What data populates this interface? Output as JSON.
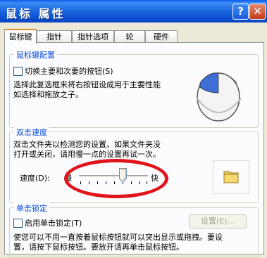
{
  "window": {
    "title": "鼠标 属性",
    "help_label": "?",
    "close_label": "✕"
  },
  "tabs": [
    "鼠标键",
    "指针",
    "指针选项",
    "轮",
    "硬件"
  ],
  "buttons_config": {
    "heading": "鼠标键配置",
    "switch_checkbox_label": "切换主要和次要的按钮(S)",
    "switch_checked": false,
    "description_line1": "选择此复选框来将右按钮设成用于主要性能",
    "description_line2": "如选择和拖放之子。"
  },
  "double_click": {
    "heading": "双击速度",
    "description_line1": "双击文件夹以检测您的设置。如果文件夹没",
    "description_line2": "打开或关闭，请用慢一点的设置再试一次。",
    "speed_label": "速度(D):",
    "slow_label": "慢",
    "fast_label": "快",
    "speed_value": 0.65,
    "test_folder_icon": "folder-icon"
  },
  "click_lock": {
    "heading": "单击锁定",
    "checkbox_label": "启用单击锁定(T)",
    "checked": false,
    "settings_button": "设置(E)...",
    "description_line1": "使您可以不用一直按着鼠标按钮就可以突出显示或拖拽。要设",
    "description_line2": "置，请按下鼠标按钮。要放开请再单击鼠标按钮。"
  },
  "annotation_color": "#e0141a"
}
